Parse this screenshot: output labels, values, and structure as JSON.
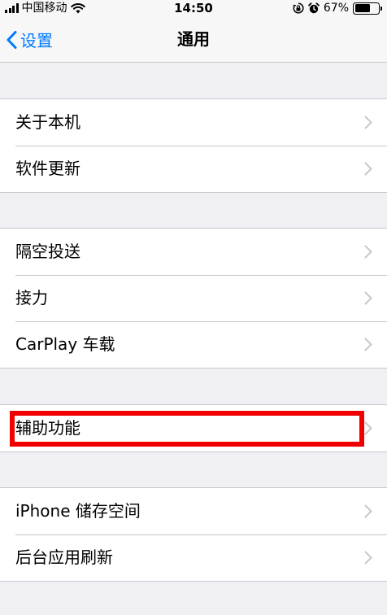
{
  "status_bar": {
    "carrier": "中国移动",
    "time": "14:50",
    "battery_percent": "67%",
    "battery_level": 0.67,
    "icons": [
      "signal-icon",
      "wifi-icon",
      "rotation-lock-icon",
      "alarm-icon",
      "battery-icon"
    ]
  },
  "nav": {
    "back_label": "设置",
    "title": "通用"
  },
  "groups": [
    {
      "items": [
        {
          "label": "关于本机"
        },
        {
          "label": "软件更新"
        }
      ]
    },
    {
      "items": [
        {
          "label": "隔空投送"
        },
        {
          "label": "接力"
        },
        {
          "label": "CarPlay 车载"
        }
      ]
    },
    {
      "items": [
        {
          "label": "辅助功能",
          "highlighted": true
        }
      ]
    },
    {
      "items": [
        {
          "label": "iPhone 储存空间"
        },
        {
          "label": "后台应用刷新"
        }
      ]
    }
  ],
  "colors": {
    "accent": "#007aff",
    "background": "#efeff4",
    "separator": "#c8c7cc",
    "chevron": "#c7c7cc",
    "highlight": "#f00000"
  }
}
